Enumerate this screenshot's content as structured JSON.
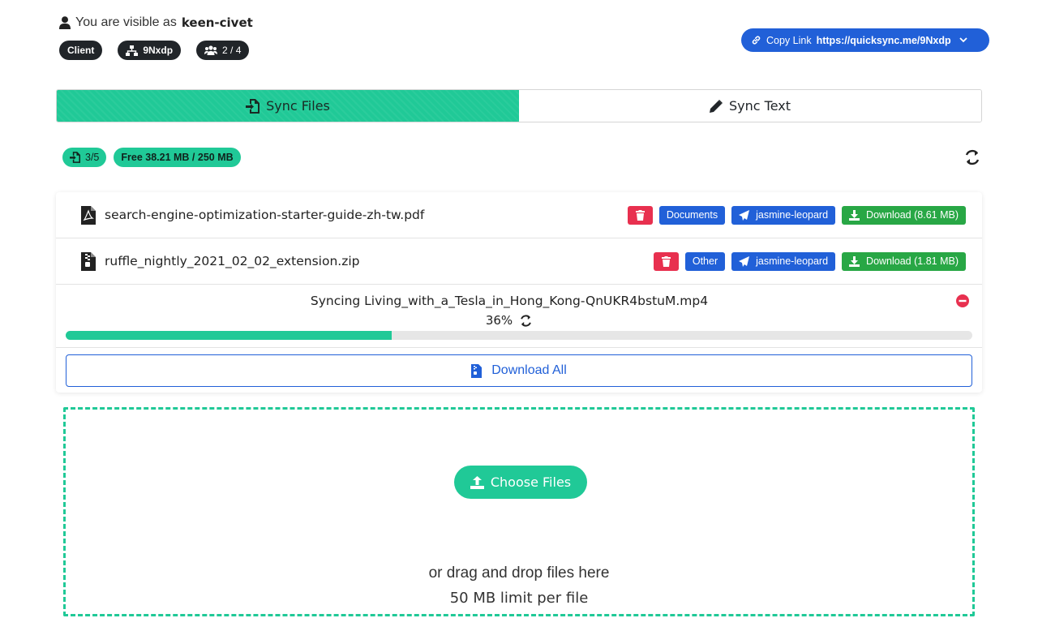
{
  "header": {
    "visible_prefix": "You are visible as",
    "username": "keen-civet",
    "role_badge": "Client",
    "room_code": "9Nxdp",
    "participants": "2 / 4",
    "copy_link_label": "Copy Link",
    "copy_link_url": "https://quicksync.me/9Nxdp"
  },
  "tabs": [
    {
      "label": "Sync Files",
      "icon": "file-import-icon",
      "active": true
    },
    {
      "label": "Sync Text",
      "icon": "pencil-icon",
      "active": false
    }
  ],
  "stats": {
    "file_count": "3/5",
    "storage": "Free 38.21 MB / 250 MB"
  },
  "files": [
    {
      "name": "search-engine-optimization-starter-guide-zh-tw.pdf",
      "icon": "file-pdf-icon",
      "category": "Documents",
      "uploader": "jasmine-leopard",
      "download_label": "Download (8.61 MB)"
    },
    {
      "name": "ruffle_nightly_2021_02_02_extension.zip",
      "icon": "file-zip-icon",
      "category": "Other",
      "uploader": "jasmine-leopard",
      "download_label": "Download (1.81 MB)"
    }
  ],
  "syncing": {
    "title": "Syncing Living_with_a_Tesla_in_Hong_Kong-QnUKR4bstuM.mp4",
    "percent_label": "36%",
    "progress": 0.36
  },
  "download_all_label": "Download All",
  "dropzone": {
    "choose_label": "Choose Files",
    "drag_text": "or drag and drop files here",
    "limit_text": "50 MB limit per file"
  },
  "colors": {
    "accent": "#20c997",
    "primary": "#2160d8",
    "danger": "#e8304f",
    "success": "#28a745",
    "dark": "#212529"
  }
}
